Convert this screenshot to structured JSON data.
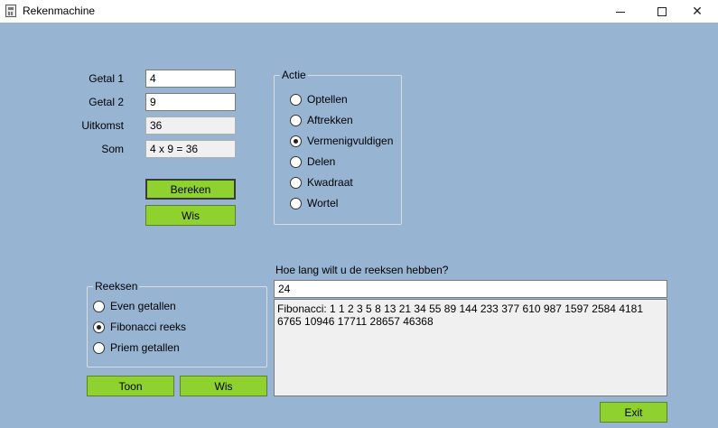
{
  "window": {
    "title": "Rekenmachine",
    "close_glyph": "✕"
  },
  "inputs": {
    "getal1_label": "Getal 1",
    "getal1_value": "4",
    "getal2_label": "Getal 2",
    "getal2_value": "9",
    "uitkomst_label": "Uitkomst",
    "uitkomst_value": "36",
    "som_label": "Som",
    "som_value": "4 x 9 = 36"
  },
  "buttons": {
    "bereken": "Bereken",
    "wis_top": "Wis",
    "toon": "Toon",
    "wis_bottom": "Wis",
    "exit": "Exit"
  },
  "actie": {
    "title": "Actie",
    "options": [
      {
        "label": "Optellen",
        "checked": false
      },
      {
        "label": "Aftrekken",
        "checked": false
      },
      {
        "label": "Vermenigvuldigen",
        "checked": true
      },
      {
        "label": "Delen",
        "checked": false
      },
      {
        "label": "Kwadraat",
        "checked": false
      },
      {
        "label": "Wortel",
        "checked": false
      }
    ]
  },
  "reeksen": {
    "title": "Reeksen",
    "options": [
      {
        "label": "Even getallen",
        "checked": false
      },
      {
        "label": "Fibonacci reeks",
        "checked": true
      },
      {
        "label": "Priem getallen",
        "checked": false
      }
    ]
  },
  "series": {
    "question": "Hoe lang wilt u de reeksen hebben?",
    "length_value": "24",
    "output": "Fibonacci: 1 1 2 3 5 8 13 21 34 55 89 144 233 377 610 987 1597 2584 4181 6765 10946 17711 28657 46368"
  }
}
